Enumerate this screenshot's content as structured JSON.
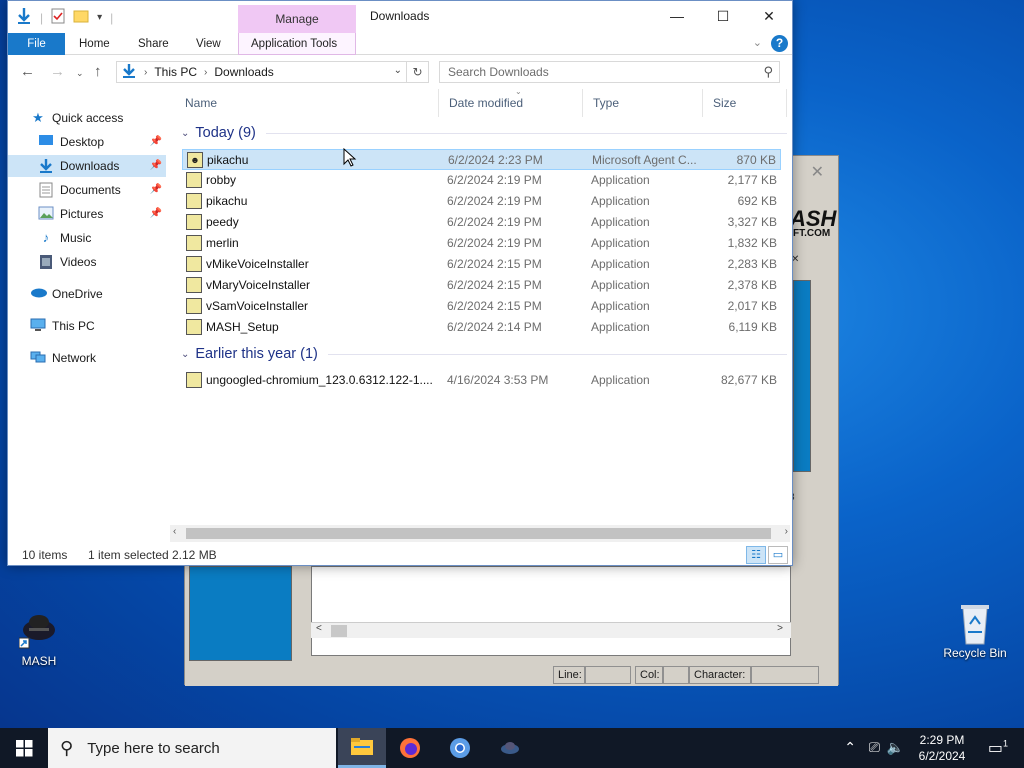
{
  "explorer": {
    "window_title": "Downloads",
    "manage_tab": "Manage",
    "ribbon_tabs": [
      "File",
      "Home",
      "Share",
      "View",
      "Application Tools"
    ],
    "address": {
      "crumbs": [
        "This PC",
        "Downloads"
      ]
    },
    "search_placeholder": "Search Downloads",
    "columns": [
      "Name",
      "Date modified",
      "Type",
      "Size"
    ],
    "nav": {
      "quick_access": "Quick access",
      "items": [
        "Desktop",
        "Downloads",
        "Documents",
        "Pictures",
        "Music",
        "Videos"
      ],
      "onedrive": "OneDrive",
      "this_pc": "This PC",
      "network": "Network"
    },
    "groups": [
      {
        "label": "Today (9)",
        "files": [
          {
            "name": "pikachu",
            "date": "6/2/2024 2:23 PM",
            "type": "Microsoft Agent C...",
            "size": "870 KB"
          },
          {
            "name": "robby",
            "date": "6/2/2024 2:19 PM",
            "type": "Application",
            "size": "2,177 KB"
          },
          {
            "name": "pikachu",
            "date": "6/2/2024 2:19 PM",
            "type": "Application",
            "size": "692 KB"
          },
          {
            "name": "peedy",
            "date": "6/2/2024 2:19 PM",
            "type": "Application",
            "size": "3,327 KB"
          },
          {
            "name": "merlin",
            "date": "6/2/2024 2:19 PM",
            "type": "Application",
            "size": "1,832 KB"
          },
          {
            "name": "vMikeVoiceInstaller",
            "date": "6/2/2024 2:15 PM",
            "type": "Application",
            "size": "2,283 KB"
          },
          {
            "name": "vMaryVoiceInstaller",
            "date": "6/2/2024 2:15 PM",
            "type": "Application",
            "size": "2,378 KB"
          },
          {
            "name": "vSamVoiceInstaller",
            "date": "6/2/2024 2:15 PM",
            "type": "Application",
            "size": "2,017 KB"
          },
          {
            "name": "MASH_Setup",
            "date": "6/2/2024 2:14 PM",
            "type": "Application",
            "size": "6,119 KB"
          }
        ]
      },
      {
        "label": "Earlier this year (1)",
        "files": [
          {
            "name": "ungoogled-chromium_123.0.6312.122-1....",
            "date": "4/16/2024 3:53 PM",
            "type": "Application",
            "size": "82,677 KB"
          }
        ]
      }
    ],
    "status": {
      "count": "10 items",
      "selected": "1 item selected",
      "size": "2.12 MB"
    }
  },
  "mash": {
    "logo": "ASH",
    "sub": "FT.COM",
    "status": {
      "line": "Line:",
      "col": "Col:",
      "character": "Character:"
    }
  },
  "desktop": {
    "icons": [
      {
        "label": "MASH"
      },
      {
        "label": "Recycle Bin"
      }
    ]
  },
  "taskbar": {
    "search_placeholder": "Type here to search",
    "time": "2:29 PM",
    "date": "6/2/2024",
    "notif_count": "1"
  }
}
